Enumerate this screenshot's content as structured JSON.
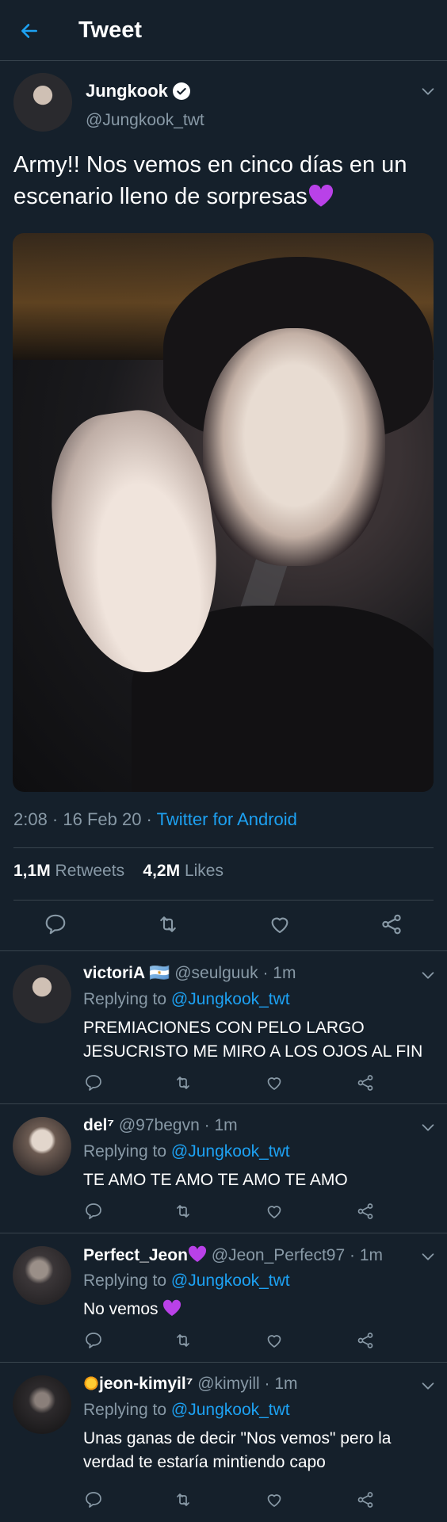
{
  "header": {
    "title": "Tweet",
    "back_icon": "arrow-left-icon"
  },
  "colors": {
    "background": "#15202b",
    "accent": "#1da1f2",
    "secondary_text": "#8899a6",
    "divider": "#38444d",
    "heart_emoji": "#b941e8"
  },
  "tweet": {
    "author_name": "Jungkook",
    "author_handle": "@Jungkook_twt",
    "verified": true,
    "text": "Army!! Nos vemos en cinco días en un escenario lleno de sorpresas",
    "text_emoji": "purple-heart",
    "time": "2:08 · 16 Feb 20 · ",
    "source": "Twitter for Android",
    "retweets_count": "1,1M",
    "retweets_label": "Retweets",
    "likes_count": "4,2M",
    "likes_label": "Likes",
    "actions": [
      "reply-icon",
      "retweet-icon",
      "like-icon",
      "share-icon"
    ]
  },
  "replies": [
    {
      "name": "victoriA 🇦🇷",
      "handle": "@seulguuk",
      "time": "1m",
      "replying_prefix": "Replying to ",
      "replying_to": "@Jungkook_twt",
      "text": "PREMIACIONES CON PELO LARGO JESUCRISTO ME MIRO A LOS OJOS AL FIN"
    },
    {
      "name": "del⁷",
      "handle": "@97begvn",
      "time": "1m",
      "replying_prefix": "Replying to ",
      "replying_to": "@Jungkook_twt",
      "text": "TE AMO TE AMO TE AMO TE AMO"
    },
    {
      "name": "Perfect_Jeon",
      "name_emoji": "purple-heart",
      "handle": "@Jeon_Perfect97",
      "time": "1m",
      "replying_prefix": "Replying to ",
      "replying_to": "@Jungkook_twt",
      "text": "No vemos",
      "text_emoji": "purple-heart"
    },
    {
      "name_emoji": "sun",
      "name": "jeon-kimyil⁷",
      "handle": "@kimyill",
      "time": "1m",
      "replying_prefix": "Replying to ",
      "replying_to": "@Jungkook_twt",
      "text": "Unas ganas de decir \"Nos vemos\" pero la verdad te estaría mintiendo capo"
    }
  ]
}
